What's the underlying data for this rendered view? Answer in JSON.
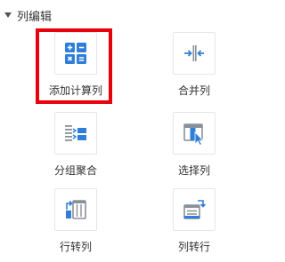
{
  "section": {
    "title": "列编辑"
  },
  "tiles": [
    {
      "label": "添加计算列",
      "icon": "calculator-icon",
      "selected": true
    },
    {
      "label": "合并列",
      "icon": "merge-columns-icon",
      "selected": false
    },
    {
      "label": "分组聚合",
      "icon": "group-aggregate-icon",
      "selected": false
    },
    {
      "label": "选择列",
      "icon": "select-column-icon",
      "selected": false
    },
    {
      "label": "行转列",
      "icon": "row-to-column-icon",
      "selected": false
    },
    {
      "label": "列转行",
      "icon": "column-to-row-icon",
      "selected": false
    }
  ],
  "colors": {
    "accent": "#2f7ed8",
    "selection_border": "#e8000b",
    "icon_grey": "#8a9099"
  }
}
